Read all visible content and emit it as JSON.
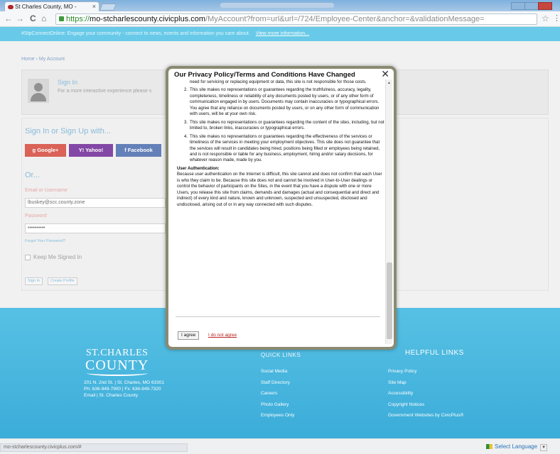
{
  "browser": {
    "tab_title": "St Charles County, MO -",
    "tab_close": "×",
    "url_https": "https://",
    "url_host": "mo-stcharlescounty.civicplus.com",
    "url_path": "/MyAccount?from=url&url=/724/Employee-Center&anchor=&validationMessage=",
    "nav": {
      "back": "←",
      "forward": "→",
      "reload": "C",
      "home": "⌂"
    },
    "star": "☆",
    "menu": "⋮"
  },
  "page": {
    "bluebar_text": "#StpConnectOnline: Engage your community - connect to news, events and information you care about.",
    "bluebar_link": "View more information...",
    "breadcrumb": "Home › My Account",
    "signin": {
      "title": "Sign In",
      "subtitle": "For a more interactive experience please s"
    },
    "login": {
      "heading": "Sign In or Sign Up with...",
      "google": "g Google+",
      "yahoo": "Y! Yahoo!",
      "facebook": "f Facebook",
      "or": "Or...",
      "email_label": "Email or Username",
      "email_value": "lbuskey@scc.county.zone",
      "password_label": "Password",
      "password_value": "••••••••••",
      "forgot": "Forgot Your Password?",
      "keep_signed_in": "Keep Me Signed In",
      "signin_button": "Sign In",
      "create_button": "Create Profile"
    },
    "footer": {
      "logo_line1": "ST.CHARLES",
      "logo_line2": "COUNTY",
      "address": [
        "201 N. 2nd St. | St. Charles, MO 63301",
        "Ph: 636-949-7900 | Fx: 636-949-7320",
        "Email | St. Charles County"
      ],
      "quick_links_heading": "QUICK LINKS",
      "quick_links": [
        "Social Media",
        "Staff Directory",
        "Careers",
        "Photo Gallery",
        "Employees Only"
      ],
      "helpful_links_heading": "HELPFUL LINKS",
      "helpful_links": [
        "Privacy Policy",
        "Site Map",
        "Accessibility",
        "Copyright Notices",
        "Government Websites by CivicPlus®"
      ]
    }
  },
  "modal": {
    "title": "Our Privacy Policy/Terms and Conditions Have Changed",
    "close": "✕",
    "scroll_up": "▲",
    "items": [
      {
        "num": "",
        "text": "need for servicing or replacing equipment or data, this site is not responsible for those costs."
      },
      {
        "num": "2.",
        "text": "This site makes no representations or guarantees regarding the truthfulness, accuracy, legality, completeness, timeliness or reliability of any documents posted by users, or of any other form of communication engaged in by users. Documents may contain inaccuracies or typographical errors. You agree that any reliance on documents posted by users, or on any other form of communication with users, will be at your own risk."
      },
      {
        "num": "3.",
        "text": "This site makes no representations or guarantees regarding the content of the sites, including, but not limited to, broken links, inaccuracies or typographical errors."
      },
      {
        "num": "4.",
        "text": "This site makes no representations or guarantees regarding the effectiveness of the services or timeliness of the services in meeting your employment objectives. This site does not guarantee that the services will result in candidates being hired, positions being filled or employees being retained, and is not responsible or liable for any business, employment, hiring and/or salary decisions, for whatever reason made, made by you."
      }
    ],
    "user_auth_heading": "User Authentication:",
    "user_auth_text": "Because user authentication on the Internet is difficult, this site cannot and does not confirm that each User is who they claim to be. Because this site does not and cannot be involved in User-to-User dealings or control the behavior of participants on the Sites, in the event that you have a dispute with one or more Users, you release this site from claims, demands and damages (actual and consequential and direct and indirect) of every kind and nature, known and unknown, suspected and unsuspected, disclosed and undisclosed, arising out of or in any way connected with such disputes.",
    "agree": "I agree",
    "disagree": "I do not agree"
  },
  "statusbar": {
    "url": "mo-stcharlescounty.civicplus.com/#",
    "language": "Select Language",
    "language_arrow": "▼"
  }
}
